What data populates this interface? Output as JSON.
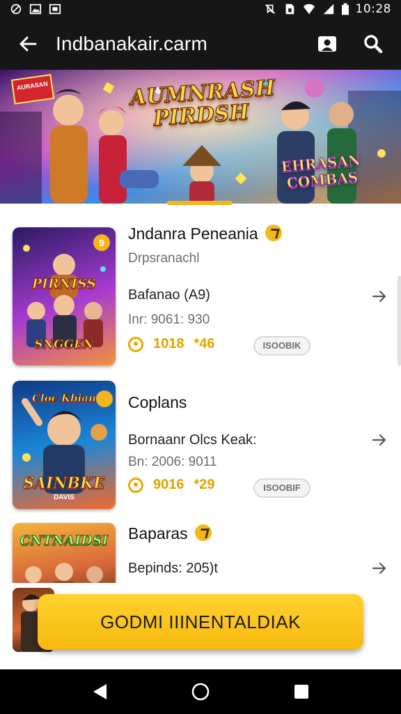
{
  "status_bar": {
    "time": "10:28",
    "left_icons": [
      "sync-icon",
      "image-icon",
      "photo-icon"
    ],
    "right_icons": [
      "mute-icon",
      "sim-icon",
      "wifi-icon",
      "signal-icon",
      "battery-icon"
    ]
  },
  "app_bar": {
    "title": "Indbanakair.carm",
    "back_icon": "arrow-left-icon",
    "actions": [
      "portrait-icon",
      "search-icon"
    ]
  },
  "banner": {
    "title": "AUMNRASH PIRDSH",
    "subtitle": "EHRASAN COMBAS",
    "tag": "AURASAN"
  },
  "games": [
    {
      "title": "Jndanra Peneania",
      "developer": "Drpsranachl",
      "line": "Bafanao (A9)",
      "info": "Inr: 9061: 930",
      "coins": "1018",
      "bonus": "*46",
      "pill": "ISOOBIK",
      "thumb_title": "PIRNISS",
      "thumb_sub": "SNGGEN",
      "thumb_badge": "9",
      "thumb_colors": [
        "#2a1a63",
        "#a73bd1",
        "#f4923b"
      ],
      "has_title_badge": true
    },
    {
      "title": "Coplans",
      "developer": "",
      "line": "Bornaanr Olcs Keak:",
      "info": "Bn: 2006: 9011",
      "coins": "9016",
      "bonus": "*29",
      "pill": "ISOOBIF",
      "thumb_title": "SAINBKE",
      "thumb_sub": "DAVIS",
      "thumb_badge": "",
      "thumb_colors": [
        "#0e3b88",
        "#1c86d8",
        "#f06a2d"
      ],
      "has_title_badge": false
    },
    {
      "title": "Baparas",
      "developer": "",
      "line": "Bepinds: 205)t",
      "info": "",
      "coins": "",
      "bonus": "",
      "pill": "",
      "thumb_title": "CNTNAIDSI",
      "thumb_sub": "",
      "thumb_badge": "",
      "thumb_colors": [
        "#f3b43b",
        "#d9673a",
        "#6a3b1e"
      ],
      "has_title_badge": true
    }
  ],
  "cta": {
    "label": "GODMI IIINENTALDIAK"
  },
  "nav_bar": {
    "items": [
      "back-triangle-icon",
      "home-circle-icon",
      "recents-square-icon"
    ]
  },
  "colors": {
    "bar_bg": "#161616",
    "accent": "#f6b90f",
    "badge": "#f3b81c"
  }
}
